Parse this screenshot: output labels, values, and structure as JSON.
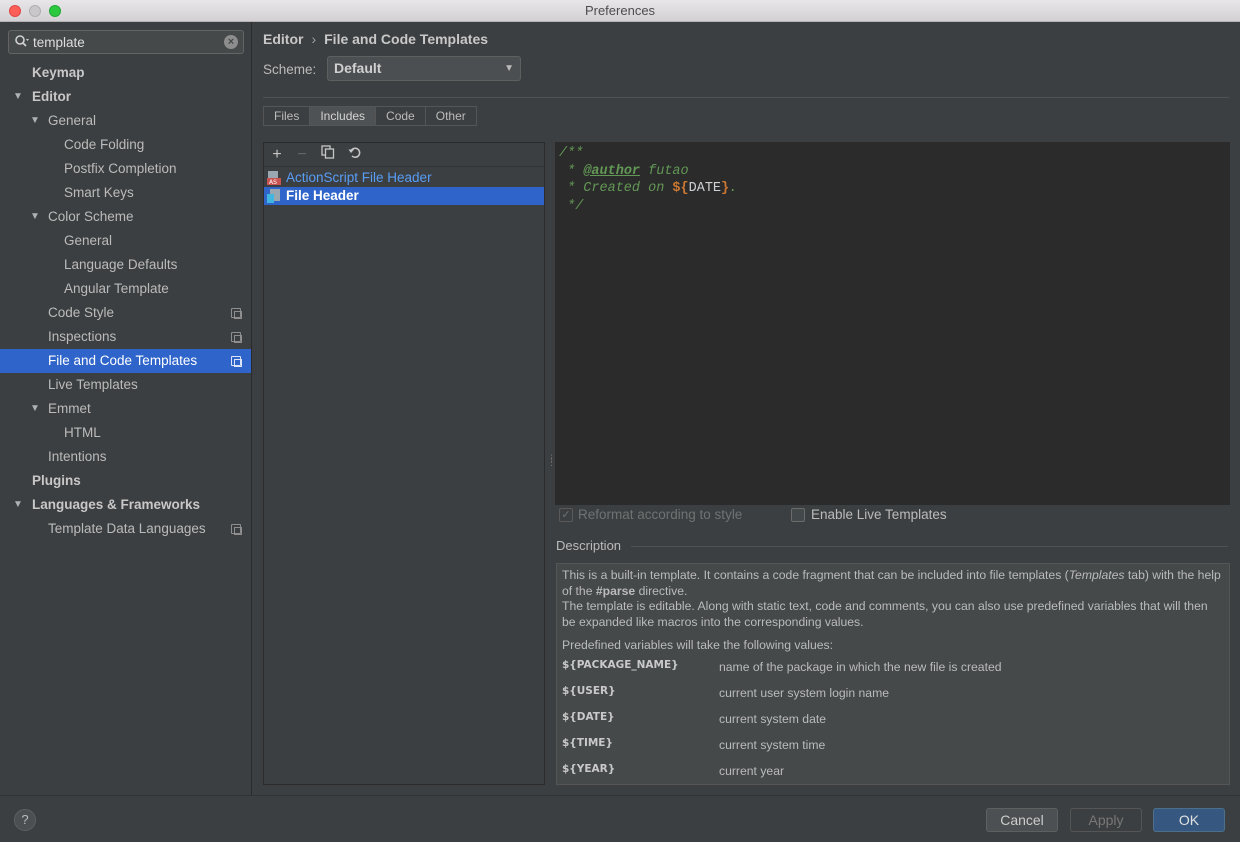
{
  "window": {
    "title": "Preferences"
  },
  "search": {
    "value": "template",
    "placeholder": ""
  },
  "sidebar": {
    "items": [
      {
        "label": "Keymap"
      },
      {
        "label": "Editor"
      },
      {
        "label": "General"
      },
      {
        "label": "Code Folding"
      },
      {
        "label": "Postfix Completion"
      },
      {
        "label": "Smart Keys"
      },
      {
        "label": "Color Scheme"
      },
      {
        "label": "General"
      },
      {
        "label": "Language Defaults"
      },
      {
        "label": "Angular Template"
      },
      {
        "label": "Code Style"
      },
      {
        "label": "Inspections"
      },
      {
        "label": "File and Code Templates"
      },
      {
        "label": "Live Templates"
      },
      {
        "label": "Emmet"
      },
      {
        "label": "HTML"
      },
      {
        "label": "Intentions"
      },
      {
        "label": "Plugins"
      },
      {
        "label": "Languages & Frameworks"
      },
      {
        "label": "Template Data Languages"
      }
    ]
  },
  "breadcrumb": {
    "parent": "Editor",
    "separator": "›",
    "current": "File and Code Templates"
  },
  "scheme": {
    "label": "Scheme:",
    "value": "Default"
  },
  "tabs": [
    {
      "label": "Files"
    },
    {
      "label": "Includes"
    },
    {
      "label": "Code"
    },
    {
      "label": "Other"
    }
  ],
  "templates": [
    {
      "label": "ActionScript File Header",
      "icon": "actionscript-file-icon"
    },
    {
      "label": "File Header",
      "icon": "file-header-icon"
    }
  ],
  "editor": {
    "line1": "/**",
    "line2_prefix": " * ",
    "line2_tag": "@author",
    "line2_rest": " futao",
    "line3_prefix": " * Created on ",
    "line3_var_open": "${",
    "line3_var": "DATE",
    "line3_var_close": "}",
    "line3_end": ".",
    "line4": " */"
  },
  "options": {
    "reformat_label": "Reformat according to style",
    "live_templates_label": "Enable Live Templates"
  },
  "description": {
    "title": "Description",
    "p1_a": "This is a built-in template. It contains a code fragment that can be included into file templates (",
    "p1_em": "Templates",
    "p1_b": " tab) with the help of the ",
    "p1_strong": "#parse",
    "p1_c": " directive.",
    "p2": "The template is editable. Along with static text, code and comments, you can also use predefined variables that will then be expanded like macros into the corresponding values.",
    "p3": "Predefined variables will take the following values:",
    "variables": [
      {
        "name": "${PACKAGE_NAME}",
        "desc": "name of the package in which the new file is created"
      },
      {
        "name": "${USER}",
        "desc": "current user system login name"
      },
      {
        "name": "${DATE}",
        "desc": "current system date"
      },
      {
        "name": "${TIME}",
        "desc": "current system time"
      },
      {
        "name": "${YEAR}",
        "desc": "current year"
      }
    ]
  },
  "buttons": {
    "help": "?",
    "cancel": "Cancel",
    "apply": "Apply",
    "ok": "OK"
  }
}
